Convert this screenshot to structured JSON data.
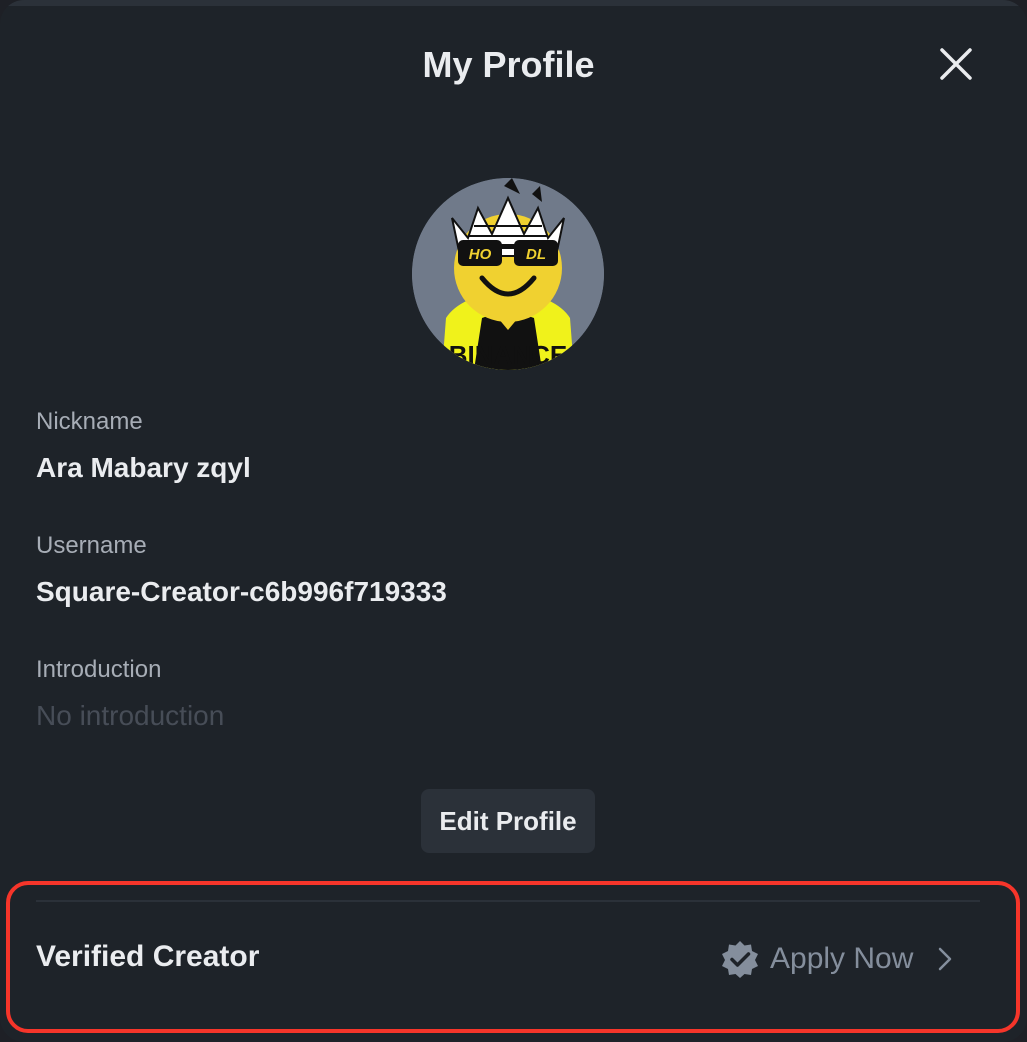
{
  "modal": {
    "title": "My Profile"
  },
  "profile": {
    "avatar_icon": "hodl-crown-smiley-avatar",
    "avatar_lettering": {
      "left_lens": "HO",
      "right_lens": "DL",
      "shirt": "BINANCE"
    },
    "fields": [
      {
        "label": "Nickname",
        "value": "Ara Mabary zqyl",
        "empty": false
      },
      {
        "label": "Username",
        "value": "Square-Creator-c6b996f719333",
        "empty": false
      },
      {
        "label": "Introduction",
        "value": "No introduction",
        "empty": true
      }
    ],
    "edit_button_label": "Edit Profile"
  },
  "verified_creator": {
    "label": "Verified Creator",
    "action_label": "Apply Now",
    "badge_icon": "verified-badge-icon",
    "chevron_icon": "chevron-right-icon"
  },
  "colors": {
    "background": "#1e2329",
    "text_primary": "#eaecef",
    "text_secondary": "#a7adb6",
    "text_muted": "#474d57",
    "button_bg": "#2b3139",
    "highlight_border": "#f6352a",
    "avatar_yellow": "#f0d130"
  }
}
